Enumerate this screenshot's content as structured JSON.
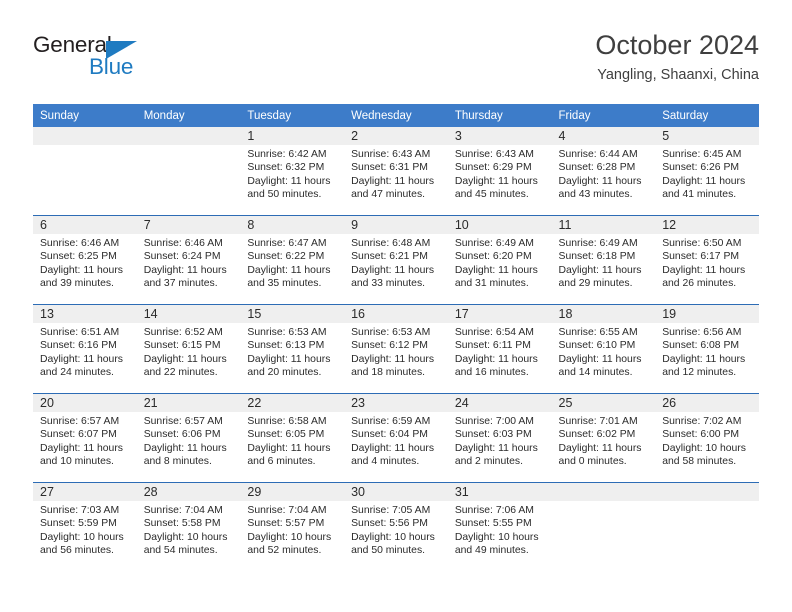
{
  "logo": {
    "word_top": "General",
    "word_bottom": "Blue",
    "triangle_icon": "triangle-icon",
    "brand_color": "#1f7bc1"
  },
  "header": {
    "title": "October 2024",
    "subtitle": "Yangling, Shaanxi, China"
  },
  "colors": {
    "header_bar": "#3d7cc9",
    "row_separator": "#2d6cb5",
    "day_band": "#efefef",
    "text": "#2b2b2b"
  },
  "weekday_headers": [
    "Sunday",
    "Monday",
    "Tuesday",
    "Wednesday",
    "Thursday",
    "Friday",
    "Saturday"
  ],
  "weeks": [
    [
      {
        "day": "",
        "empty": true
      },
      {
        "day": "",
        "empty": true
      },
      {
        "day": "1",
        "sunrise": "Sunrise: 6:42 AM",
        "sunset": "Sunset: 6:32 PM",
        "daylight_line1": "Daylight: 11 hours",
        "daylight_line2": "and 50 minutes."
      },
      {
        "day": "2",
        "sunrise": "Sunrise: 6:43 AM",
        "sunset": "Sunset: 6:31 PM",
        "daylight_line1": "Daylight: 11 hours",
        "daylight_line2": "and 47 minutes."
      },
      {
        "day": "3",
        "sunrise": "Sunrise: 6:43 AM",
        "sunset": "Sunset: 6:29 PM",
        "daylight_line1": "Daylight: 11 hours",
        "daylight_line2": "and 45 minutes."
      },
      {
        "day": "4",
        "sunrise": "Sunrise: 6:44 AM",
        "sunset": "Sunset: 6:28 PM",
        "daylight_line1": "Daylight: 11 hours",
        "daylight_line2": "and 43 minutes."
      },
      {
        "day": "5",
        "sunrise": "Sunrise: 6:45 AM",
        "sunset": "Sunset: 6:26 PM",
        "daylight_line1": "Daylight: 11 hours",
        "daylight_line2": "and 41 minutes."
      }
    ],
    [
      {
        "day": "6",
        "sunrise": "Sunrise: 6:46 AM",
        "sunset": "Sunset: 6:25 PM",
        "daylight_line1": "Daylight: 11 hours",
        "daylight_line2": "and 39 minutes."
      },
      {
        "day": "7",
        "sunrise": "Sunrise: 6:46 AM",
        "sunset": "Sunset: 6:24 PM",
        "daylight_line1": "Daylight: 11 hours",
        "daylight_line2": "and 37 minutes."
      },
      {
        "day": "8",
        "sunrise": "Sunrise: 6:47 AM",
        "sunset": "Sunset: 6:22 PM",
        "daylight_line1": "Daylight: 11 hours",
        "daylight_line2": "and 35 minutes."
      },
      {
        "day": "9",
        "sunrise": "Sunrise: 6:48 AM",
        "sunset": "Sunset: 6:21 PM",
        "daylight_line1": "Daylight: 11 hours",
        "daylight_line2": "and 33 minutes."
      },
      {
        "day": "10",
        "sunrise": "Sunrise: 6:49 AM",
        "sunset": "Sunset: 6:20 PM",
        "daylight_line1": "Daylight: 11 hours",
        "daylight_line2": "and 31 minutes."
      },
      {
        "day": "11",
        "sunrise": "Sunrise: 6:49 AM",
        "sunset": "Sunset: 6:18 PM",
        "daylight_line1": "Daylight: 11 hours",
        "daylight_line2": "and 29 minutes."
      },
      {
        "day": "12",
        "sunrise": "Sunrise: 6:50 AM",
        "sunset": "Sunset: 6:17 PM",
        "daylight_line1": "Daylight: 11 hours",
        "daylight_line2": "and 26 minutes."
      }
    ],
    [
      {
        "day": "13",
        "sunrise": "Sunrise: 6:51 AM",
        "sunset": "Sunset: 6:16 PM",
        "daylight_line1": "Daylight: 11 hours",
        "daylight_line2": "and 24 minutes."
      },
      {
        "day": "14",
        "sunrise": "Sunrise: 6:52 AM",
        "sunset": "Sunset: 6:15 PM",
        "daylight_line1": "Daylight: 11 hours",
        "daylight_line2": "and 22 minutes."
      },
      {
        "day": "15",
        "sunrise": "Sunrise: 6:53 AM",
        "sunset": "Sunset: 6:13 PM",
        "daylight_line1": "Daylight: 11 hours",
        "daylight_line2": "and 20 minutes."
      },
      {
        "day": "16",
        "sunrise": "Sunrise: 6:53 AM",
        "sunset": "Sunset: 6:12 PM",
        "daylight_line1": "Daylight: 11 hours",
        "daylight_line2": "and 18 minutes."
      },
      {
        "day": "17",
        "sunrise": "Sunrise: 6:54 AM",
        "sunset": "Sunset: 6:11 PM",
        "daylight_line1": "Daylight: 11 hours",
        "daylight_line2": "and 16 minutes."
      },
      {
        "day": "18",
        "sunrise": "Sunrise: 6:55 AM",
        "sunset": "Sunset: 6:10 PM",
        "daylight_line1": "Daylight: 11 hours",
        "daylight_line2": "and 14 minutes."
      },
      {
        "day": "19",
        "sunrise": "Sunrise: 6:56 AM",
        "sunset": "Sunset: 6:08 PM",
        "daylight_line1": "Daylight: 11 hours",
        "daylight_line2": "and 12 minutes."
      }
    ],
    [
      {
        "day": "20",
        "sunrise": "Sunrise: 6:57 AM",
        "sunset": "Sunset: 6:07 PM",
        "daylight_line1": "Daylight: 11 hours",
        "daylight_line2": "and 10 minutes."
      },
      {
        "day": "21",
        "sunrise": "Sunrise: 6:57 AM",
        "sunset": "Sunset: 6:06 PM",
        "daylight_line1": "Daylight: 11 hours",
        "daylight_line2": "and 8 minutes."
      },
      {
        "day": "22",
        "sunrise": "Sunrise: 6:58 AM",
        "sunset": "Sunset: 6:05 PM",
        "daylight_line1": "Daylight: 11 hours",
        "daylight_line2": "and 6 minutes."
      },
      {
        "day": "23",
        "sunrise": "Sunrise: 6:59 AM",
        "sunset": "Sunset: 6:04 PM",
        "daylight_line1": "Daylight: 11 hours",
        "daylight_line2": "and 4 minutes."
      },
      {
        "day": "24",
        "sunrise": "Sunrise: 7:00 AM",
        "sunset": "Sunset: 6:03 PM",
        "daylight_line1": "Daylight: 11 hours",
        "daylight_line2": "and 2 minutes."
      },
      {
        "day": "25",
        "sunrise": "Sunrise: 7:01 AM",
        "sunset": "Sunset: 6:02 PM",
        "daylight_line1": "Daylight: 11 hours",
        "daylight_line2": "and 0 minutes."
      },
      {
        "day": "26",
        "sunrise": "Sunrise: 7:02 AM",
        "sunset": "Sunset: 6:00 PM",
        "daylight_line1": "Daylight: 10 hours",
        "daylight_line2": "and 58 minutes."
      }
    ],
    [
      {
        "day": "27",
        "sunrise": "Sunrise: 7:03 AM",
        "sunset": "Sunset: 5:59 PM",
        "daylight_line1": "Daylight: 10 hours",
        "daylight_line2": "and 56 minutes."
      },
      {
        "day": "28",
        "sunrise": "Sunrise: 7:04 AM",
        "sunset": "Sunset: 5:58 PM",
        "daylight_line1": "Daylight: 10 hours",
        "daylight_line2": "and 54 minutes."
      },
      {
        "day": "29",
        "sunrise": "Sunrise: 7:04 AM",
        "sunset": "Sunset: 5:57 PM",
        "daylight_line1": "Daylight: 10 hours",
        "daylight_line2": "and 52 minutes."
      },
      {
        "day": "30",
        "sunrise": "Sunrise: 7:05 AM",
        "sunset": "Sunset: 5:56 PM",
        "daylight_line1": "Daylight: 10 hours",
        "daylight_line2": "and 50 minutes."
      },
      {
        "day": "31",
        "sunrise": "Sunrise: 7:06 AM",
        "sunset": "Sunset: 5:55 PM",
        "daylight_line1": "Daylight: 10 hours",
        "daylight_line2": "and 49 minutes."
      },
      {
        "day": "",
        "empty": true
      },
      {
        "day": "",
        "empty": true
      }
    ]
  ]
}
